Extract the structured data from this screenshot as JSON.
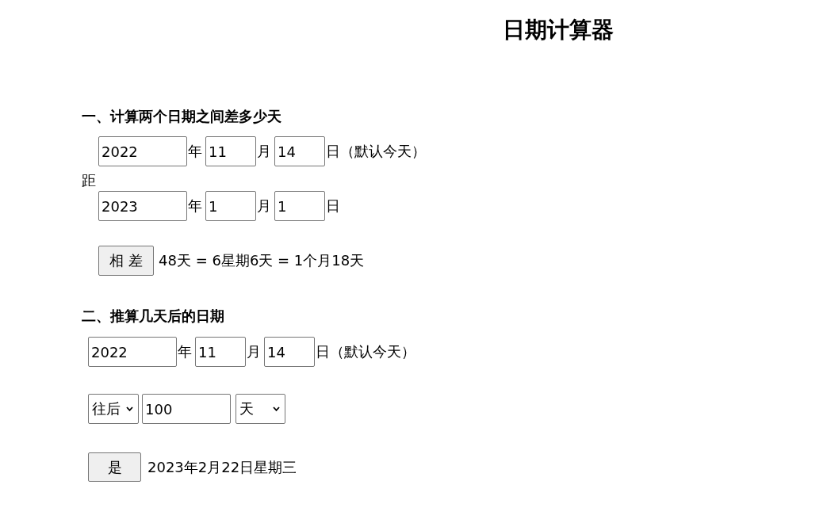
{
  "title": "日期计算器",
  "difference_section": {
    "heading": "一、计算两个日期之间差多少天",
    "start_date": {
      "year": "2022",
      "year_unit": "年",
      "month": "11",
      "month_unit": "月",
      "day": "14",
      "day_unit": "日",
      "note": "（默认今天）"
    },
    "connector": "距",
    "end_date": {
      "year": "2023",
      "year_unit": "年",
      "month": "1",
      "month_unit": "月",
      "day": "1",
      "day_unit": "日"
    },
    "button": "相 差",
    "result": "48天 = 6星期6天 = 1个月18天"
  },
  "offset_section": {
    "heading": "二、推算几天后的日期",
    "start_date": {
      "year": "2022",
      "year_unit": "年",
      "month": "11",
      "month_unit": "月",
      "day": "14",
      "day_unit": "日",
      "note": "（默认今天）"
    },
    "direction": "往后",
    "amount": "100",
    "unit": "天",
    "button": "是",
    "result": "2023年2月22日星期三"
  }
}
